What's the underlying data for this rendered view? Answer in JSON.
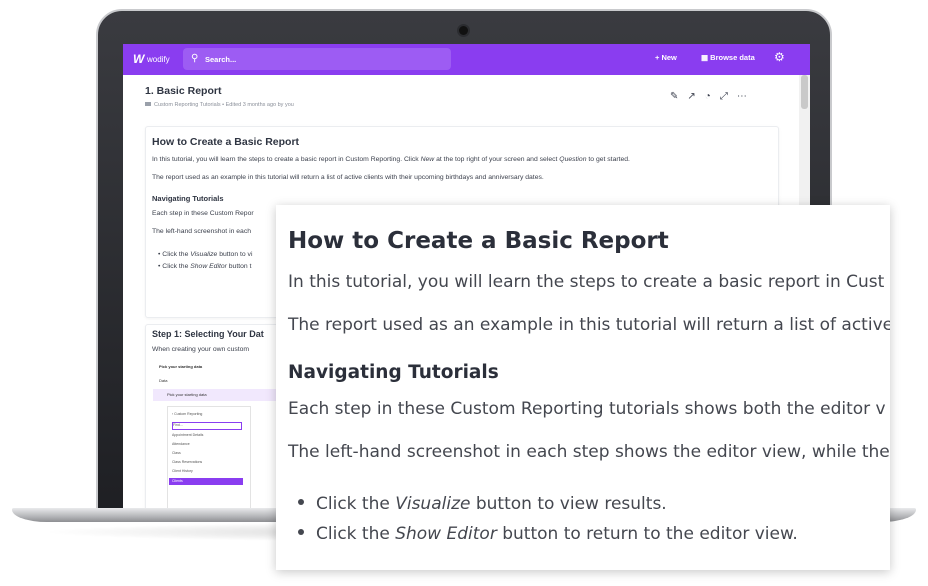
{
  "app": {
    "brand_mark": "W",
    "brand_name": "wodify",
    "search_placeholder": "Search...",
    "new_label": "+ New",
    "browse_label": "Browse data"
  },
  "doc": {
    "title": "1. Basic Report",
    "breadcrumb": "Custom Reporting Tutorials",
    "edited": "Edited 3 months ago by you"
  },
  "card1": {
    "heading": "How to Create a Basic Report",
    "intro_a": "In this tutorial, you will learn the steps to create a basic report in Custom Reporting. Click ",
    "intro_new": "New",
    "intro_b": " at the top right of your screen and select ",
    "intro_question": "Question",
    "intro_c": " to get started.",
    "report_note": "The report used as an example in this tutorial will return a list of active clients with their upcoming birthdays and anniversary dates.",
    "subheading": "Navigating Tutorials",
    "nav_p1": "Each step in these Custom Repor",
    "nav_p2": "The left-hand screenshot in each",
    "bullet1_a": "Click the ",
    "bullet1_em": "Visualize",
    "bullet1_b": " button to vi",
    "bullet2_a": "Click the ",
    "bullet2_em": "Show Editor",
    "bullet2_b": " button t"
  },
  "card2": {
    "heading": "Step 1: Selecting Your Dat",
    "intro": "When creating your own custom"
  },
  "mini": {
    "pick_label": "Pick your starting data",
    "data_label": "Data",
    "band_label": "Pick your starting data",
    "back_label": "Custom Reporting",
    "find_placeholder": "Find...",
    "items": [
      "Appointment Details",
      "Attendance",
      "Class",
      "Class Reservations",
      "Client History",
      "Clients"
    ]
  },
  "zoom": {
    "heading": "How to Create a Basic Report",
    "p1": "In this tutorial, you will learn the steps to create a basic report in Cust",
    "p2": "The report used as an example in this tutorial will return a list of active",
    "subheading": "Navigating Tutorials",
    "p3": "Each step in these Custom Reporting tutorials shows both the editor v",
    "p4": "The left-hand screenshot in each step shows the editor view, while the",
    "li1_a": "Click the ",
    "li1_em": "Visualize",
    "li1_b": " button to view results.",
    "li2_a": "Click the ",
    "li2_em": "Show Editor",
    "li2_b": " button to return to the editor view."
  },
  "colors": {
    "accent": "#8a3df0",
    "text": "#44474f"
  },
  "icons": [
    "search-icon",
    "gear-icon",
    "edit-icon",
    "share-icon",
    "history-icon",
    "fullscreen-icon",
    "more-icon",
    "folder-icon",
    "grid-icon"
  ]
}
